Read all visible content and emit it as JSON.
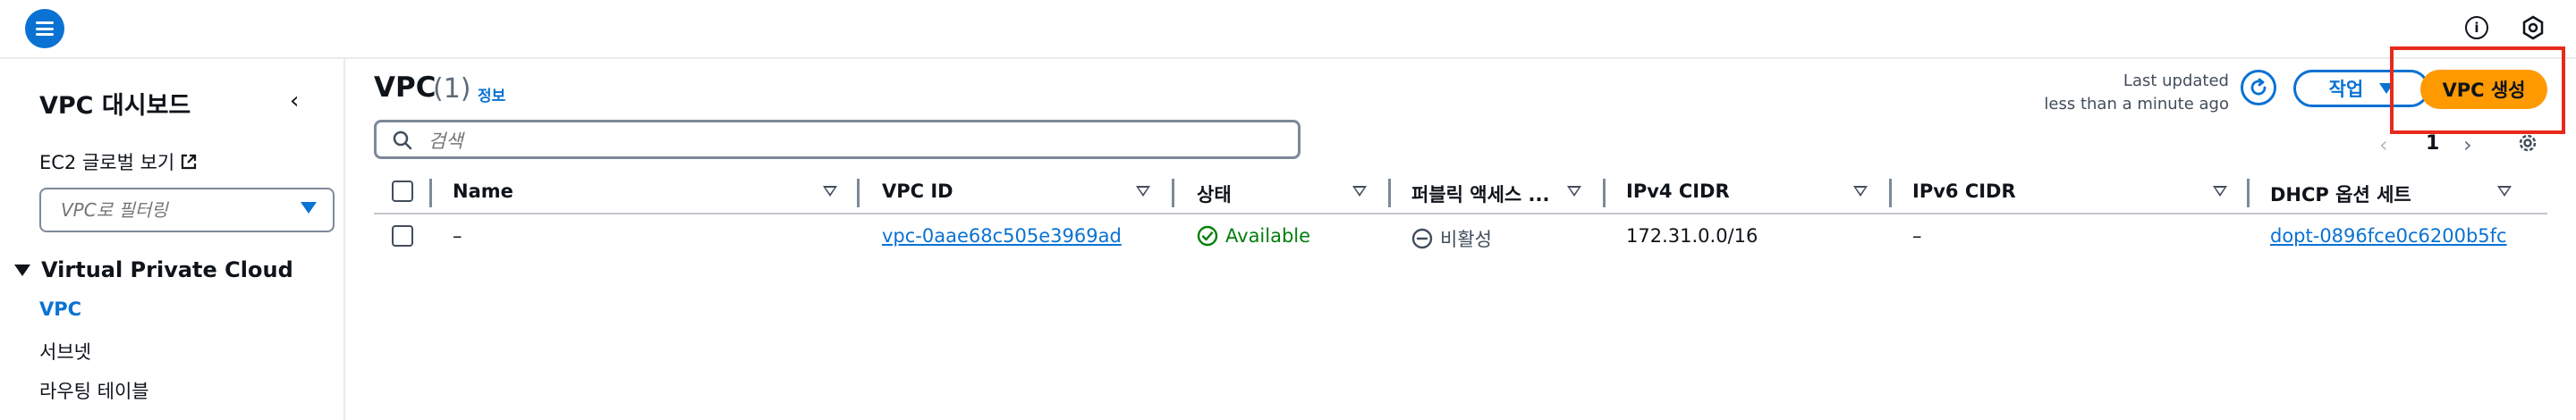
{
  "header": {
    "menu_icon": "hamburger-menu-icon",
    "info_icon": "info-icon",
    "settings_icon": "settings-hex-icon"
  },
  "sidebar": {
    "title": "VPC 대시보드",
    "ec2_link": "EC2 글로벌 보기",
    "filter_placeholder": "VPC로 필터링",
    "section": "Virtual Private Cloud",
    "items": [
      {
        "label": "VPC",
        "active": true
      },
      {
        "label": "서브넷"
      },
      {
        "label": "라우팅 테이블"
      }
    ]
  },
  "main": {
    "title": "VPC",
    "count": "(1)",
    "info": "정보",
    "last_updated_label": "Last updated",
    "last_updated_value": "less than a minute ago",
    "actions_label": "작업",
    "create_label": "VPC 생성",
    "search_placeholder": "검색",
    "page_number": "1"
  },
  "table": {
    "columns": [
      "Name",
      "VPC ID",
      "상태",
      "퍼블릭 액세스 ...",
      "IPv4 CIDR",
      "IPv6 CIDR",
      "DHCP 옵션 세트"
    ],
    "rows": [
      {
        "name": "–",
        "vpc_id": "vpc-0aae68c505e3969ad",
        "state": "Available",
        "public_access": "비활성",
        "ipv4": "172.31.0.0/16",
        "ipv6": "–",
        "dhcp": "dopt-0896fce0c6200b5fc"
      }
    ]
  },
  "colors": {
    "accent": "#0972d3",
    "primary_button": "#ff9900",
    "success": "#037f0c",
    "highlight_border": "#e8291c"
  }
}
